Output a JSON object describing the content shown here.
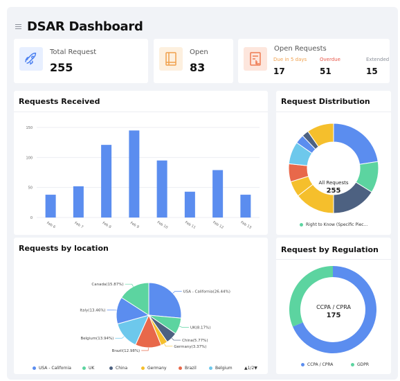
{
  "header": {
    "title": "DSAR Dashboard"
  },
  "kpis": {
    "total": {
      "label": "Total Request",
      "value": "255"
    },
    "open": {
      "label": "Open",
      "value": "83"
    },
    "open_requests": {
      "label": "Open Requests",
      "due": {
        "label": "Due in 5 days",
        "value": "17"
      },
      "overdue": {
        "label": "Overdue",
        "value": "51"
      },
      "extended": {
        "label": "Extended",
        "value": "15"
      }
    }
  },
  "requests_received": {
    "title": "Requests Received"
  },
  "request_distribution": {
    "title": "Request Distribution",
    "center_label": "All Requests",
    "center_value": "255",
    "legend": "Right to Know (Specific Piec..."
  },
  "requests_by_location": {
    "title": "Requests by location",
    "pager": "▲1/2▼",
    "legend": [
      "USA - California",
      "UK",
      "China",
      "Germany",
      "Brazil",
      "Belgium"
    ]
  },
  "request_by_regulation": {
    "title": "Request by Regulation",
    "center_label": "CCPA / CPRA",
    "center_value": "175",
    "legend": [
      "CCPA / CPRA",
      "GDPR"
    ]
  },
  "colors": {
    "blue": "#5b8def",
    "green": "#5cd4a0",
    "navy": "#4d6181",
    "yellow": "#f5bf2c",
    "red": "#e8684a",
    "sky": "#6dc8ec",
    "orange": "#ff9f43",
    "purple": "#9270ca"
  },
  "chart_data": [
    {
      "type": "bar",
      "title": "Requests Received",
      "categories": [
        "Feb 6",
        "Feb 7",
        "Feb 8",
        "Feb 9",
        "Feb 10",
        "Feb 11",
        "Feb 12",
        "Feb 13"
      ],
      "values": [
        38,
        52,
        121,
        145,
        95,
        43,
        79,
        38
      ],
      "ylim": [
        0,
        150
      ],
      "yticks": [
        0,
        50,
        100,
        150
      ],
      "grid": true
    },
    {
      "type": "pie",
      "title": "Request Distribution",
      "donut": true,
      "legend": [
        "Right to Know (Specific Piec..."
      ],
      "values": [
        28,
        14,
        20,
        18,
        7,
        8,
        10,
        4,
        3,
        12
      ],
      "colors": [
        "#5b8def",
        "#5cd4a0",
        "#4d6181",
        "#f5bf2c",
        "#f5bf2c",
        "#e8684a",
        "#6dc8ec",
        "#5b8def",
        "#4d6181",
        "#f5bf2c"
      ]
    },
    {
      "type": "pie",
      "title": "Requests by location",
      "slices": [
        {
          "label": "USA - California(26.44%)",
          "value": 26.44,
          "color": "#5b8def"
        },
        {
          "label": "UK(8.17%)",
          "value": 8.17,
          "color": "#5cd4a0"
        },
        {
          "label": "China(5.77%)",
          "value": 5.77,
          "color": "#4d6181"
        },
        {
          "label": "Germany(3.37%)",
          "value": 3.37,
          "color": "#f5bf2c"
        },
        {
          "label": "Brazil(12.98%)",
          "value": 12.98,
          "color": "#e8684a"
        },
        {
          "label": "Belgium(13.94%)",
          "value": 13.94,
          "color": "#6dc8ec"
        },
        {
          "label": "Italy(13.46%)",
          "value": 13.46,
          "color": "#5b8def"
        },
        {
          "label": "Canada(15.87%)",
          "value": 15.87,
          "color": "#5cd4a0"
        }
      ]
    },
    {
      "type": "pie",
      "title": "Request by Regulation",
      "donut": true,
      "slices": [
        {
          "label": "CCPA / CPRA",
          "value": 175,
          "color": "#5b8def"
        },
        {
          "label": "GDPR",
          "value": 80,
          "color": "#5cd4a0"
        }
      ]
    }
  ]
}
